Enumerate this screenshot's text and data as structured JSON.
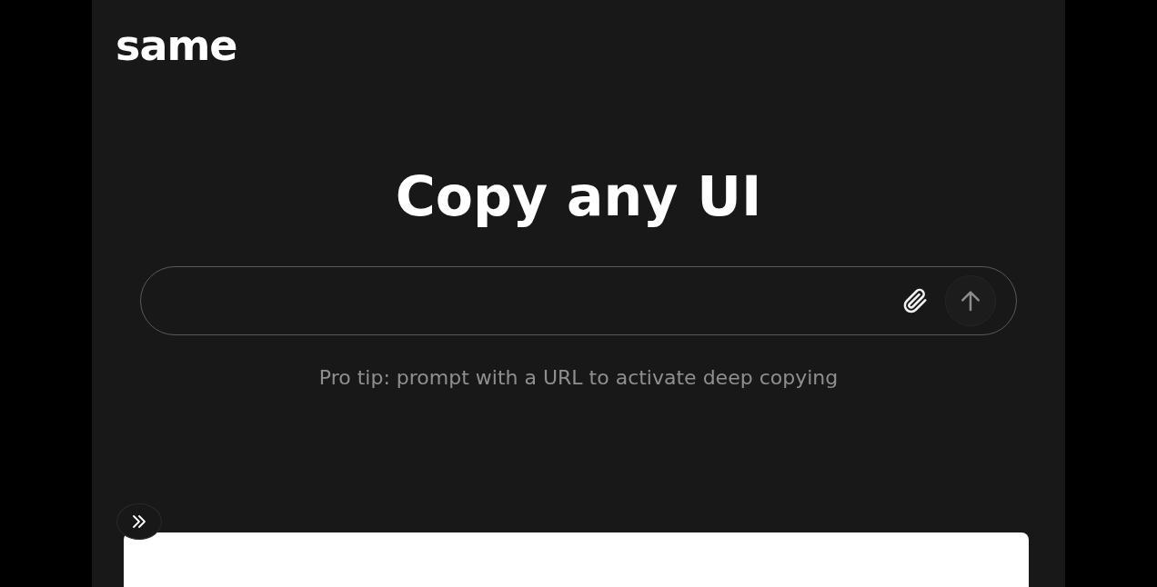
{
  "logo": "same",
  "headline": "Copy any UI",
  "tip": "Pro tip: prompt with a URL to activate deep copying"
}
